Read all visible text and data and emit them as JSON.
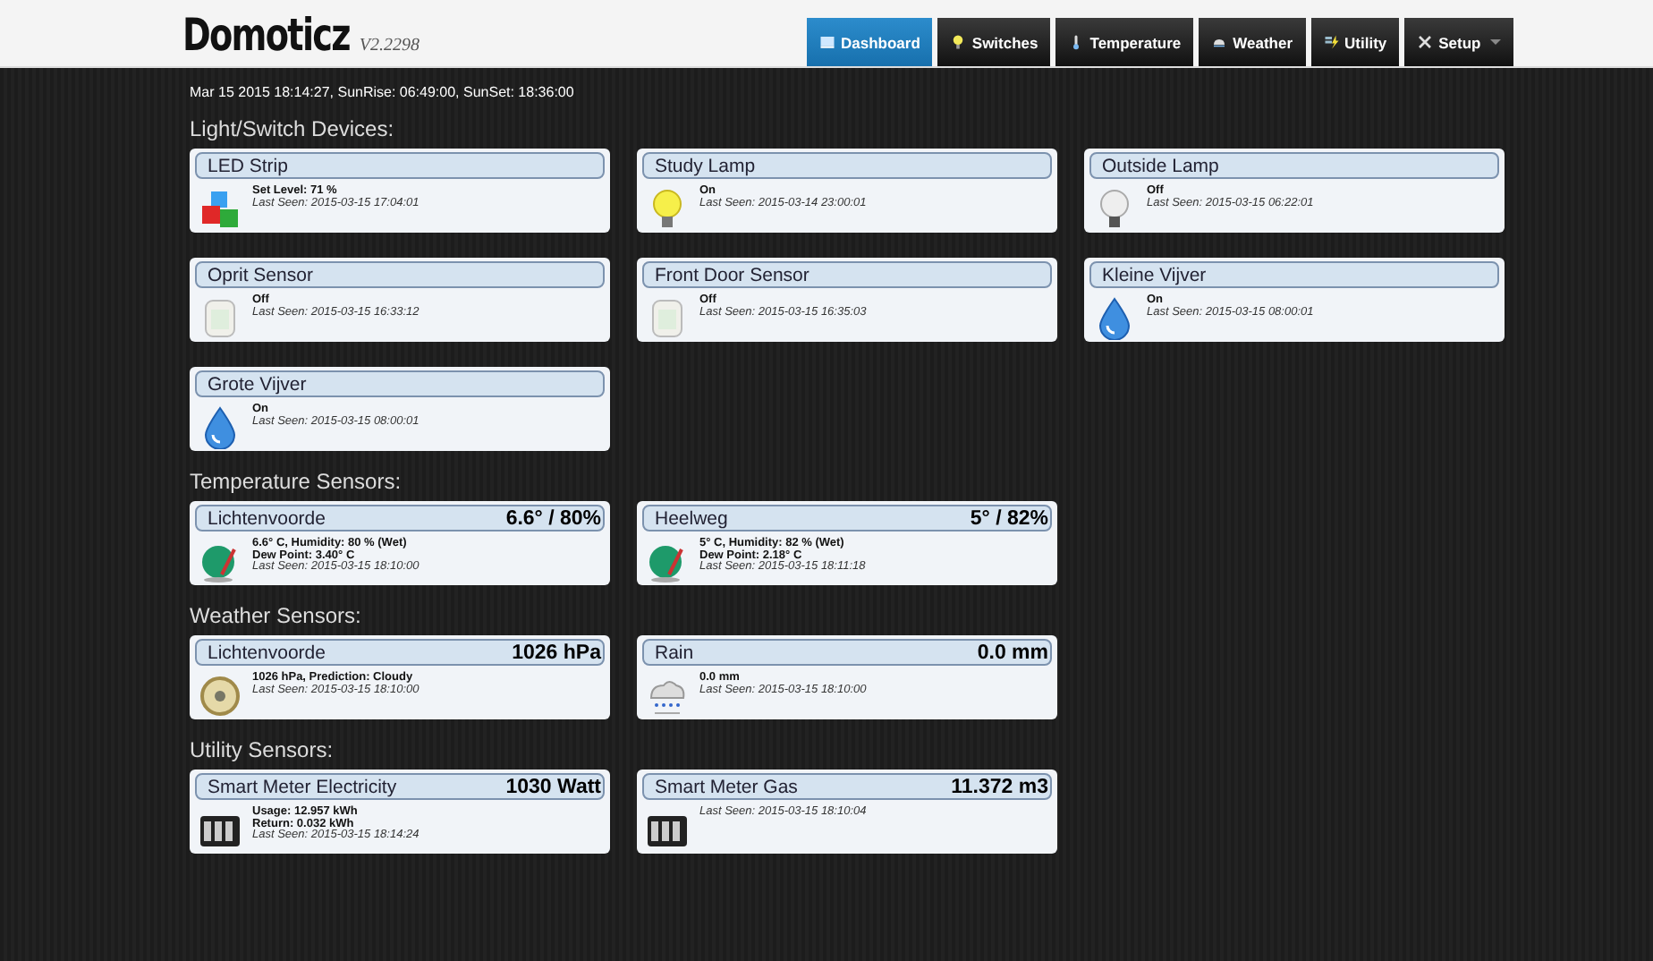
{
  "header": {
    "logo": "Domoticz",
    "version": "V2.2298"
  },
  "nav": [
    {
      "label": "Dashboard",
      "kind": "dashboard",
      "selected": true,
      "dropdown": false
    },
    {
      "label": "Switches",
      "kind": "switches",
      "selected": false,
      "dropdown": false
    },
    {
      "label": "Temperature",
      "kind": "temperature",
      "selected": false,
      "dropdown": false
    },
    {
      "label": "Weather",
      "kind": "weather",
      "selected": false,
      "dropdown": false
    },
    {
      "label": "Utility",
      "kind": "utility",
      "selected": false,
      "dropdown": false
    },
    {
      "label": "Setup",
      "kind": "setup",
      "selected": false,
      "dropdown": true
    }
  ],
  "status_line": "Mar 15 2015 18:14:27, SunRise: 06:49:00, SunSet: 18:36:00",
  "sections": [
    {
      "title": "Light/Switch Devices:",
      "devices": [
        {
          "name": "LED Strip",
          "kind": "dimmer",
          "lines": [
            "Set Level: 71 %"
          ],
          "last_seen": "Last Seen: 2015-03-15 17:04:01"
        },
        {
          "name": "Study Lamp",
          "kind": "lamp",
          "on": true,
          "lines": [
            "On"
          ],
          "last_seen": "Last Seen: 2015-03-14 23:00:01"
        },
        {
          "name": "Outside Lamp",
          "kind": "lamp",
          "on": false,
          "lines": [
            "Off"
          ],
          "last_seen": "Last Seen: 2015-03-15 06:22:01"
        },
        {
          "name": "Oprit Sensor",
          "kind": "motion",
          "lines": [
            "Off"
          ],
          "last_seen": "Last Seen: 2015-03-15 16:33:12"
        },
        {
          "name": "Front Door Sensor",
          "kind": "motion",
          "lines": [
            "Off"
          ],
          "last_seen": "Last Seen: 2015-03-15 16:35:03"
        },
        {
          "name": "Kleine Vijver",
          "kind": "pump",
          "lines": [
            "On"
          ],
          "last_seen": "Last Seen: 2015-03-15 08:00:01"
        },
        {
          "name": "Grote Vijver",
          "kind": "pump",
          "lines": [
            "On"
          ],
          "last_seen": "Last Seen: 2015-03-15 08:00:01"
        }
      ]
    },
    {
      "title": "Temperature Sensors:",
      "devices": [
        {
          "name": "Lichtenvoorde",
          "value": "6.6° / 80%",
          "kind": "temperature",
          "lines": [
            "6.6° C, Humidity: 80 % (Wet)",
            "Dew Point: 3.40° C"
          ],
          "last_seen": "Last Seen: 2015-03-15 18:10:00"
        },
        {
          "name": "Heelweg",
          "value": "5° / 82%",
          "kind": "temperature",
          "lines": [
            "5° C, Humidity: 82 % (Wet)",
            "Dew Point: 2.18° C"
          ],
          "last_seen": "Last Seen: 2015-03-15 18:11:18"
        }
      ]
    },
    {
      "title": "Weather Sensors:",
      "devices": [
        {
          "name": "Lichtenvoorde",
          "value": "1026 hPa",
          "kind": "pressure",
          "lines": [
            "1026 hPa, Prediction: Cloudy"
          ],
          "last_seen": "Last Seen: 2015-03-15 18:10:00"
        },
        {
          "name": "Rain",
          "value": "0.0 mm",
          "kind": "rain",
          "lines": [
            "0.0 mm"
          ],
          "last_seen": "Last Seen: 2015-03-15 18:10:00"
        }
      ]
    },
    {
      "title": "Utility Sensors:",
      "devices": [
        {
          "name": "Smart Meter Electricity",
          "value": "1030 Watt",
          "kind": "meter",
          "lines": [
            "Usage: 12.957 kWh",
            "Return: 0.032 kWh"
          ],
          "last_seen": "Last Seen: 2015-03-15 18:14:24"
        },
        {
          "name": "Smart Meter Gas",
          "value": "11.372 m3",
          "kind": "meter",
          "last_seen": "Last Seen: 2015-03-15 18:10:04"
        }
      ]
    }
  ]
}
